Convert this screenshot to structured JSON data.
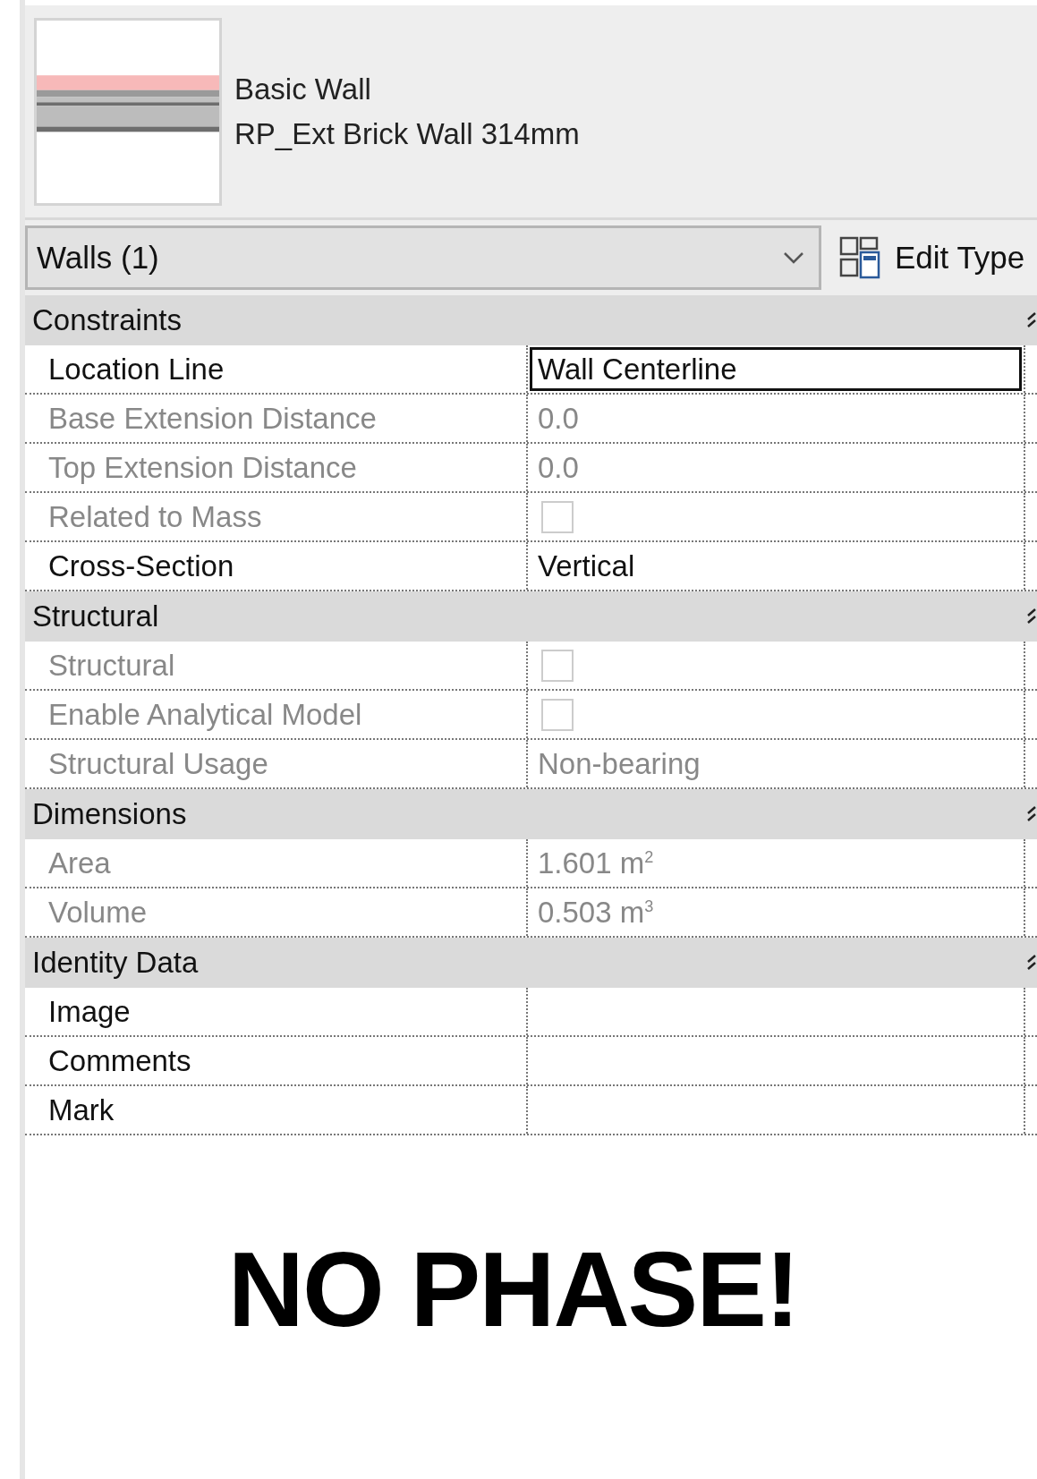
{
  "type_selector": {
    "family": "Basic Wall",
    "type": "RP_Ext Brick Wall 314mm"
  },
  "filter": {
    "value": "Walls (1)"
  },
  "edit_type_button": {
    "label": "Edit Type"
  },
  "groups": [
    {
      "title": "Constraints",
      "rows": [
        {
          "label": "Location Line",
          "kind": "text",
          "value": "Wall Centerline",
          "disabled": false,
          "selected": true
        },
        {
          "label": "Base Extension Distance",
          "kind": "text",
          "value": "0.0",
          "disabled": true,
          "selected": false
        },
        {
          "label": "Top Extension Distance",
          "kind": "text",
          "value": "0.0",
          "disabled": true,
          "selected": false
        },
        {
          "label": "Related to Mass",
          "kind": "checkbox",
          "checked": false,
          "disabled": true,
          "selected": false
        },
        {
          "label": "Cross-Section",
          "kind": "text",
          "value": "Vertical",
          "disabled": false,
          "selected": false
        }
      ]
    },
    {
      "title": "Structural",
      "rows": [
        {
          "label": "Structural",
          "kind": "checkbox",
          "checked": false,
          "disabled": true,
          "selected": false
        },
        {
          "label": "Enable Analytical Model",
          "kind": "checkbox",
          "checked": false,
          "disabled": true,
          "selected": false
        },
        {
          "label": "Structural Usage",
          "kind": "text",
          "value": "Non-bearing",
          "disabled": true,
          "selected": false
        }
      ]
    },
    {
      "title": "Dimensions",
      "rows": [
        {
          "label": "Area",
          "kind": "text",
          "value": "1.601 m$^{2}$",
          "disabled": true,
          "selected": false
        },
        {
          "label": "Volume",
          "kind": "text",
          "value": "0.503 m$^{3}$",
          "disabled": true,
          "selected": false
        }
      ]
    },
    {
      "title": "Identity Data",
      "rows": [
        {
          "label": "Image",
          "kind": "empty",
          "disabled": false,
          "selected": false
        },
        {
          "label": "Comments",
          "kind": "empty",
          "disabled": false,
          "selected": false
        },
        {
          "label": "Mark",
          "kind": "empty",
          "disabled": false,
          "selected": false
        }
      ]
    }
  ],
  "caption": "NO PHASE!"
}
